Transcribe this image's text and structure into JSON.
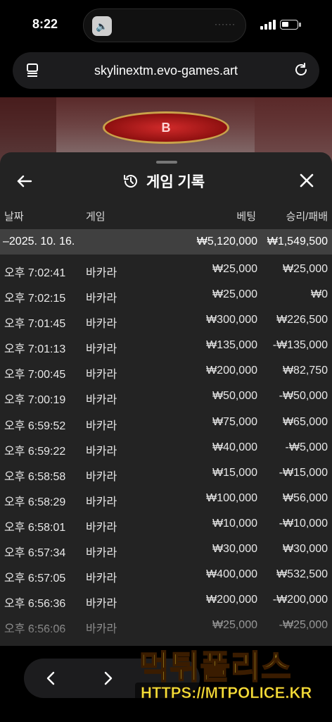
{
  "status_bar": {
    "time": "8:22"
  },
  "browser": {
    "url": "skylinextm.evo-games.art"
  },
  "game": {
    "banker_label": "B"
  },
  "panel": {
    "title": "게임 기록",
    "columns": {
      "date": "날짜",
      "game": "게임",
      "bet": "베팅",
      "result": "승리/패배"
    },
    "date_row": {
      "date": "–2025. 10. 16.",
      "bet_total": "₩5,120,000",
      "result_total": "₩1,549,500"
    },
    "rows": [
      {
        "time": "오후 7:02:41",
        "game": "바카라",
        "bet": "₩25,000",
        "result": "₩25,000"
      },
      {
        "time": "오후 7:02:15",
        "game": "바카라",
        "bet": "₩25,000",
        "result": "₩0"
      },
      {
        "time": "오후 7:01:45",
        "game": "바카라",
        "bet": "₩300,000",
        "result": "₩226,500"
      },
      {
        "time": "오후 7:01:13",
        "game": "바카라",
        "bet": "₩135,000",
        "result": "-₩135,000"
      },
      {
        "time": "오후 7:00:45",
        "game": "바카라",
        "bet": "₩200,000",
        "result": "₩82,750"
      },
      {
        "time": "오후 7:00:19",
        "game": "바카라",
        "bet": "₩50,000",
        "result": "-₩50,000"
      },
      {
        "time": "오후 6:59:52",
        "game": "바카라",
        "bet": "₩75,000",
        "result": "₩65,000"
      },
      {
        "time": "오후 6:59:22",
        "game": "바카라",
        "bet": "₩40,000",
        "result": "-₩5,000"
      },
      {
        "time": "오후 6:58:58",
        "game": "바카라",
        "bet": "₩15,000",
        "result": "-₩15,000"
      },
      {
        "time": "오후 6:58:29",
        "game": "바카라",
        "bet": "₩100,000",
        "result": "₩56,000"
      },
      {
        "time": "오후 6:58:01",
        "game": "바카라",
        "bet": "₩10,000",
        "result": "-₩10,000"
      },
      {
        "time": "오후 6:57:34",
        "game": "바카라",
        "bet": "₩30,000",
        "result": "₩30,000"
      },
      {
        "time": "오후 6:57:05",
        "game": "바카라",
        "bet": "₩400,000",
        "result": "₩532,500"
      },
      {
        "time": "오후 6:56:36",
        "game": "바카라",
        "bet": "₩200,000",
        "result": "-₩200,000"
      },
      {
        "time": "오후 6:56:06",
        "game": "바카라",
        "bet": "₩25,000",
        "result": "-₩25,000"
      }
    ]
  },
  "watermark": {
    "title": "먹튀폴리스",
    "url": "HTTPS://MTPOLICE.KR"
  },
  "colors": {
    "panel_bg": "#232323",
    "date_row_bg": "#404040",
    "watermark": "#f4e13a"
  },
  "icons": [
    "back-arrow-icon",
    "history-icon",
    "close-icon",
    "tabs-icon",
    "reload-icon",
    "chevron-left-icon",
    "chevron-right-icon"
  ]
}
